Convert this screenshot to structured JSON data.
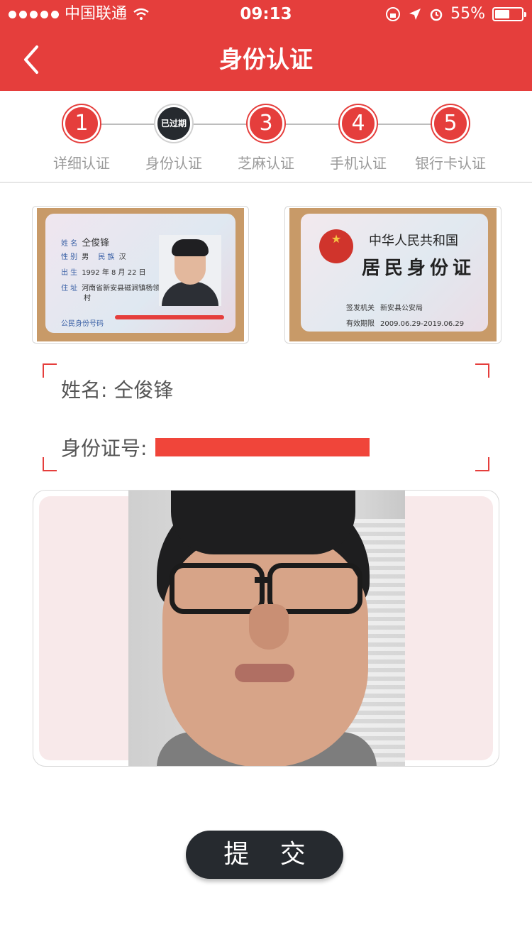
{
  "status_bar": {
    "carrier": "中国联通",
    "time": "09:13",
    "battery": "55%",
    "battery_level": 0.55
  },
  "header": {
    "title": "身份认证",
    "back_icon": "chevron-left-icon"
  },
  "steps": [
    {
      "number": "1",
      "label": "详细认证",
      "state": "done"
    },
    {
      "number": "已过期",
      "label": "身份认证",
      "state": "expired"
    },
    {
      "number": "3",
      "label": "芝麻认证",
      "state": "done"
    },
    {
      "number": "4",
      "label": "手机认证",
      "state": "done"
    },
    {
      "number": "5",
      "label": "银行卡认证",
      "state": "done"
    }
  ],
  "id_front": {
    "name_key": "姓 名",
    "name": "仝俊锋",
    "sex_key": "性 别",
    "sex": "男",
    "ethnic_key": "民 族",
    "ethnic": "汉",
    "birth_key": "出 生",
    "birth": "1992 年 8 月 22 日",
    "address_key": "住 址",
    "address": "河南省新安县磁涧镇杨领",
    "address2": "村",
    "id_key": "公民身份号码"
  },
  "id_back": {
    "country": "中华人民共和国",
    "card_title": "居民身份证",
    "authority_key": "签发机关",
    "authority": "新安县公安局",
    "valid_key": "有效期限",
    "valid": "2009.06.29-2019.06.29"
  },
  "info": {
    "name_line": "姓名: 仝俊锋",
    "id_label": "身份证号:"
  },
  "submit_label": "提 交",
  "colors": {
    "brand_red": "#e53e3c",
    "dark_button": "#262a2f"
  }
}
